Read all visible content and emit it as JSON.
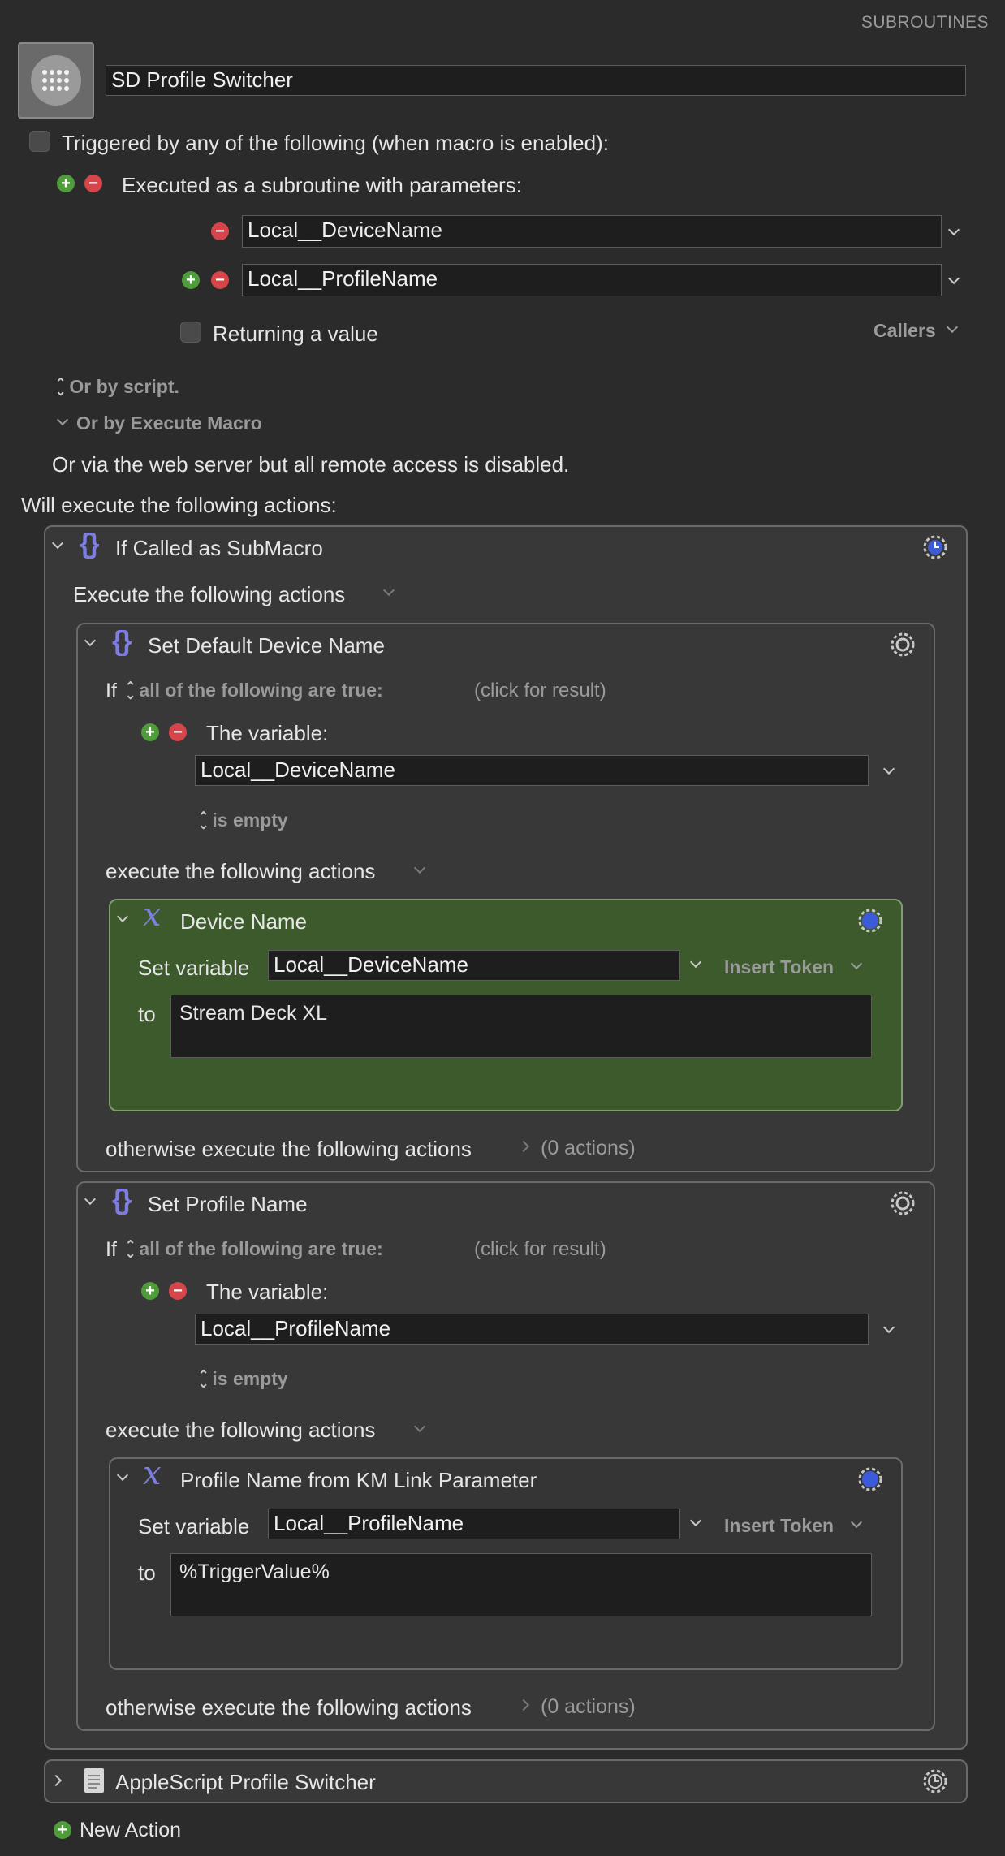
{
  "header": {
    "section_label": "SUBROUTINES",
    "macro_name": "SD Profile Switcher"
  },
  "trigger": {
    "triggered_label": "Triggered by any of the following (when macro is enabled):",
    "subroutine_label": "Executed as a subroutine with parameters:",
    "params": [
      "Local__DeviceName",
      "Local__ProfileName"
    ],
    "returning_label": "Returning a value",
    "callers_label": "Callers",
    "by_script_label": "Or by script.",
    "by_execute_macro_label": "Or by Execute Macro",
    "web_server_label": "Or via the web server but all remote access is disabled."
  },
  "actions_header": "Will execute the following actions:",
  "if_called": {
    "title": "If Called as SubMacro",
    "execute_label": "Execute the following actions"
  },
  "set_device": {
    "title": "Set Default Device Name",
    "if_label": "If",
    "condition": "all of the following are true:",
    "click_result": "(click for result)",
    "variable_label": "The variable:",
    "variable": "Local__DeviceName",
    "test": "is empty",
    "execute_label": "execute the following actions",
    "otherwise_label": "otherwise execute the following actions",
    "otherwise_count": "(0 actions)",
    "action": {
      "title": "Device Name",
      "set_variable_label": "Set variable",
      "variable": "Local__DeviceName",
      "insert_token": "Insert Token",
      "to_label": "to",
      "value": "Stream Deck XL"
    }
  },
  "set_profile": {
    "title": "Set Profile Name",
    "if_label": "If",
    "condition": "all of the following are true:",
    "click_result": "(click for result)",
    "variable_label": "The variable:",
    "variable": "Local__ProfileName",
    "test": "is empty",
    "execute_label": "execute the following actions",
    "otherwise_label": "otherwise execute the following actions",
    "otherwise_count": "(0 actions)",
    "action": {
      "title": "Profile Name from KM Link Parameter",
      "set_variable_label": "Set variable",
      "variable": "Local__ProfileName",
      "insert_token": "Insert Token",
      "to_label": "to",
      "value": "%TriggerValue%"
    }
  },
  "applescript": {
    "title": "AppleScript Profile Switcher"
  },
  "new_action_label": "New Action",
  "icons": {
    "macro_icon": "keypad-grid-icon",
    "braces": "if-then-icon",
    "x": "variable-icon",
    "gear": "gear-icon",
    "doc": "document-icon"
  },
  "colors": {
    "background": "#2b2b2b",
    "panel": "#383838",
    "green_panel": "#3c5a2c",
    "accent_purple": "#7d7ee0",
    "plus_green": "#4f9d3a",
    "minus_red": "#d6454a"
  }
}
